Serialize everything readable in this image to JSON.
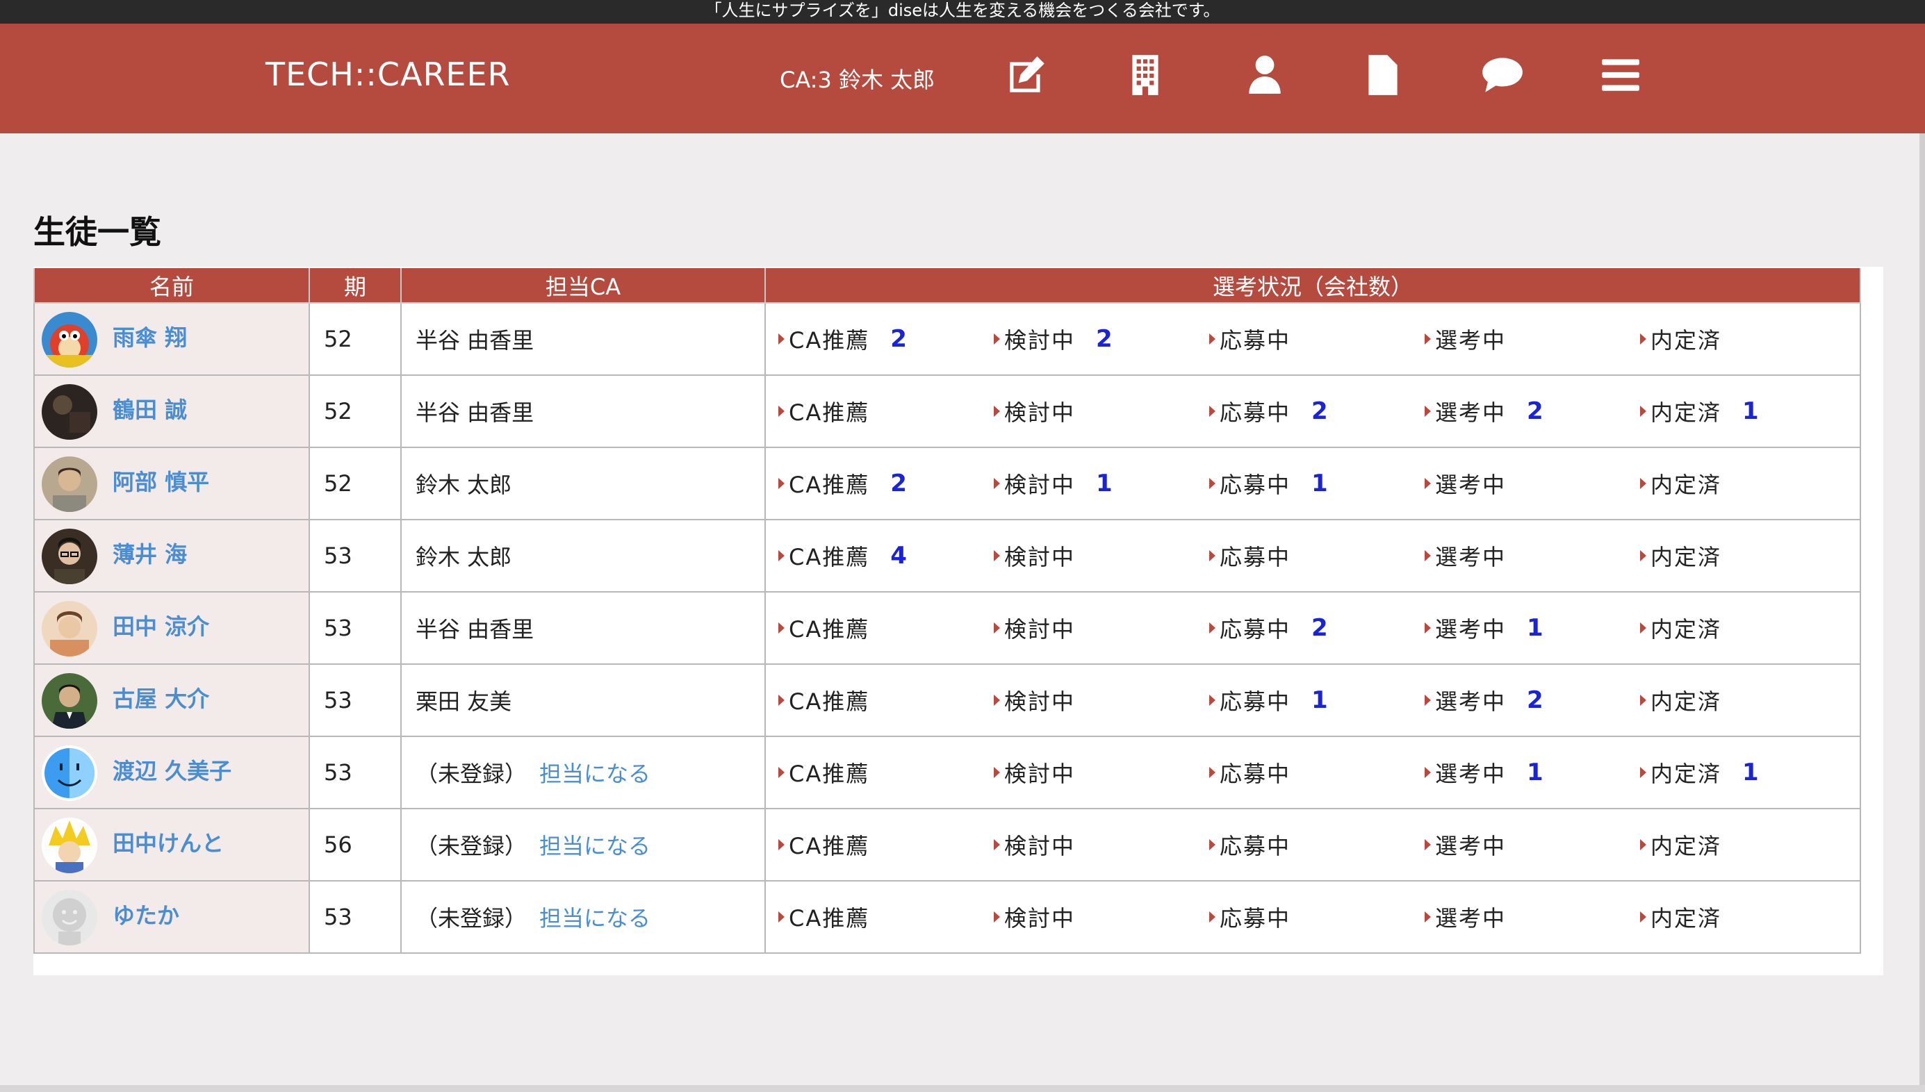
{
  "topbar": {
    "tagline": "「人生にサプライズを」diseは人生を変える機会をつくる会社です。"
  },
  "header": {
    "brand": "TECH::CAREER",
    "user_label": "CA:3 鈴木 太郎",
    "nav_icons": [
      "edit-icon",
      "building-icon",
      "user-icon",
      "document-icon",
      "chat-icon",
      "menu-icon"
    ]
  },
  "page": {
    "title": "生徒一覧"
  },
  "table": {
    "headers": {
      "name": "名前",
      "term": "期",
      "ca": "担当CA",
      "status": "選考状況（会社数）"
    },
    "status_labels": [
      "CA推薦",
      "検討中",
      "応募中",
      "選考中",
      "内定済"
    ],
    "unregistered_label": "（未登録）",
    "assign_label": "担当になる",
    "rows": [
      {
        "name": "雨傘 翔",
        "term": "52",
        "ca": "半谷 由香里",
        "counts": [
          "2",
          "2",
          "",
          "",
          ""
        ],
        "avatar": "cartoon-red"
      },
      {
        "name": "鶴田 誠",
        "term": "52",
        "ca": "半谷 由香里",
        "counts": [
          "",
          "",
          "2",
          "2",
          "1"
        ],
        "avatar": "dark-photo"
      },
      {
        "name": "阿部 慎平",
        "term": "52",
        "ca": "鈴木 太郎",
        "counts": [
          "2",
          "1",
          "1",
          "",
          ""
        ],
        "avatar": "person-photo"
      },
      {
        "name": "薄井 海",
        "term": "53",
        "ca": "鈴木 太郎",
        "counts": [
          "4",
          "",
          "",
          "",
          ""
        ],
        "avatar": "person-glasses"
      },
      {
        "name": "田中 涼介",
        "term": "53",
        "ca": "半谷 由香里",
        "counts": [
          "",
          "",
          "2",
          "1",
          ""
        ],
        "avatar": "person-light"
      },
      {
        "name": "古屋 大介",
        "term": "53",
        "ca": "栗田 友美",
        "counts": [
          "",
          "",
          "1",
          "2",
          ""
        ],
        "avatar": "person-suit"
      },
      {
        "name": "渡辺 久美子",
        "term": "53",
        "ca": "",
        "counts": [
          "",
          "",
          "",
          "1",
          "1"
        ],
        "avatar": "finder-face"
      },
      {
        "name": "田中けんと",
        "term": "56",
        "ca": "",
        "counts": [
          "",
          "",
          "",
          "",
          ""
        ],
        "avatar": "anime-yellow"
      },
      {
        "name": "ゆたか",
        "term": "53",
        "ca": "",
        "counts": [
          "",
          "",
          "",
          "",
          ""
        ],
        "avatar": "default-avatar"
      }
    ]
  },
  "colors": {
    "header": "#b54b3e",
    "link": "#4a8dd0",
    "count": "#1a24d6",
    "name_bg": "#f2ebea"
  }
}
